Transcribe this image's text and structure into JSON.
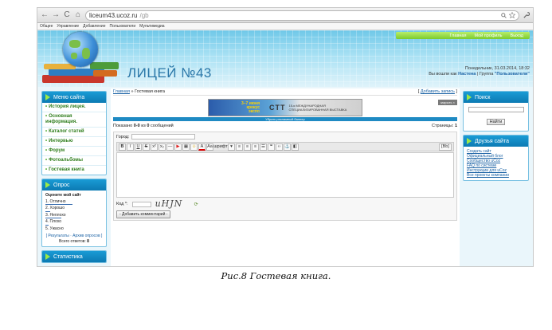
{
  "browser": {
    "back": "←",
    "forward": "→",
    "reload": "C",
    "home": "⌂",
    "url_host": "liceum43.ucoz.ru",
    "url_path": "/gb",
    "search_icon": "search-icon",
    "star_icon": "star-icon"
  },
  "admin_bar": [
    "Общее",
    "Управление",
    "Добавление",
    "Пользователи",
    "Мультимедиа"
  ],
  "topnav": [
    "Главная",
    "Мой профиль",
    "Выход"
  ],
  "site_title": "ЛИЦЕЙ №43",
  "date_line": "Понедельник, 31.03.2014, 18:32",
  "welcome": {
    "prefix": "Вы вошли как",
    "user": "Настена",
    "group_prefix": "| Группа",
    "group": "\"Пользователи\""
  },
  "menu": {
    "title": "Меню сайта",
    "items": [
      "История лицея.",
      "Основная информация.",
      "Каталог статей",
      "Интервью",
      "Форум",
      "Фотоальбомы",
      "Гостевая книга"
    ]
  },
  "poll": {
    "title": "Опрос",
    "question": "Оцените мой сайт",
    "options": [
      "1. Отлично",
      "2. Хорошо",
      "3. Неплохо",
      "4. Плохо",
      "5. Ужасно"
    ],
    "results_label": "Результаты",
    "archive_label": "Архив опросов",
    "total_label": "Всего ответов:",
    "total": "8"
  },
  "stats": {
    "title": "Статистика"
  },
  "content": {
    "breadcrumb_home": "Главная",
    "breadcrumb_sep": "»",
    "breadcrumb_current": "Гостевая книга",
    "add_entry": "Добавить запись",
    "banner_left": "3–7 июня",
    "banner_left2": "крокус",
    "banner_left3": "экспо",
    "banner_ctt": "CTT",
    "banner_sub": "15-я МЕЖДУНАРОДНАЯ СПЕЦИАЛИЗИРОВАННАЯ ВЫСТАВКА",
    "close_ad": "закрыть ×",
    "remove_ad": "Убрать рекламный баннер",
    "shown": "Показано",
    "shown_range": "0-0",
    "of": "из",
    "shown_total": "0",
    "messages": "сообщений",
    "pages_label": "Страницы:",
    "pages_value": "1",
    "city_label": "Город:",
    "font_label": "шрифт",
    "captcha_label": "Код *:",
    "captcha_text": "uHJN",
    "submit": "- Добавить комментарий -"
  },
  "search": {
    "title": "Поиск",
    "button": "Найти"
  },
  "friends": {
    "title": "Друзья сайта",
    "links": [
      "Создать сайт",
      "Официальный блог",
      "Сообщество uCoz",
      "FAQ по системе",
      "Инструкции для uCoz",
      "Все проекты компании"
    ]
  },
  "caption": "Рис.8 Гостевая книга.",
  "colors": {
    "accent": "#1a9bd5",
    "menu_green": "#2e7d1c",
    "topnav": "#7ccb2c"
  }
}
